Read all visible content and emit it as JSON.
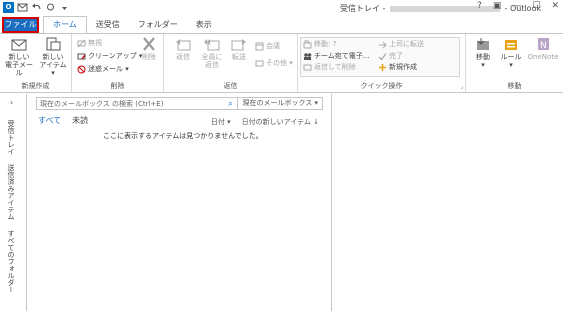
{
  "titlebar": {
    "title_prefix": "受信トレイ - ",
    "title_suffix": " - Outlook",
    "app_icon_text": "O",
    "controls": [
      "?",
      "▣",
      "—",
      "☐",
      "✕"
    ]
  },
  "tabs": {
    "file": "ファイル",
    "home": "ホーム",
    "send_receive": "送受信",
    "folder": "フォルダー",
    "view": "表示"
  },
  "ribbon": {
    "new_group": {
      "label": "新規作成",
      "new_mail": "新しい\n電子メール",
      "new_items": "新しい\nアイテム ▾"
    },
    "delete_group": {
      "label": "削除",
      "ignore": "無視",
      "cleanup": "クリーンアップ ▾",
      "junk": "迷惑メール ▾",
      "delete": "削除"
    },
    "respond_group": {
      "label": "返信",
      "reply": "返信",
      "reply_all": "全員に\n返信",
      "forward": "転送",
      "meeting": "会議",
      "more": "その他 ▾"
    },
    "quick_steps_group": {
      "label": "クイック操作",
      "items": [
        "移動: ?",
        "チーム宛て電子...",
        "返信して削除",
        "上司に転送",
        "完了",
        "新規作成"
      ]
    },
    "move_group": {
      "label": "移動",
      "move": "移動\n▾",
      "rules": "ルール\n▾",
      "onenote": "OneNote"
    }
  },
  "leftpane": {
    "collapse": "›",
    "inbox": "受信トレイ",
    "sent": "送信済みアイテム",
    "all_folders": "すべてのフォルダー"
  },
  "main": {
    "search_placeholder": "現在のメールボックス の検索 (Ctrl+E)",
    "search_scope": "現在のメールボックス ▾",
    "filter_all": "すべて",
    "filter_unread": "未読",
    "sort_by": "日付 ▾",
    "sort_order": "日付の新しいアイテム ↓",
    "empty_message": "ここに表示するアイテムは見つかりませんでした。"
  },
  "colors": {
    "accent": "#1b6dc1",
    "file_highlight_border": "#d40000"
  }
}
